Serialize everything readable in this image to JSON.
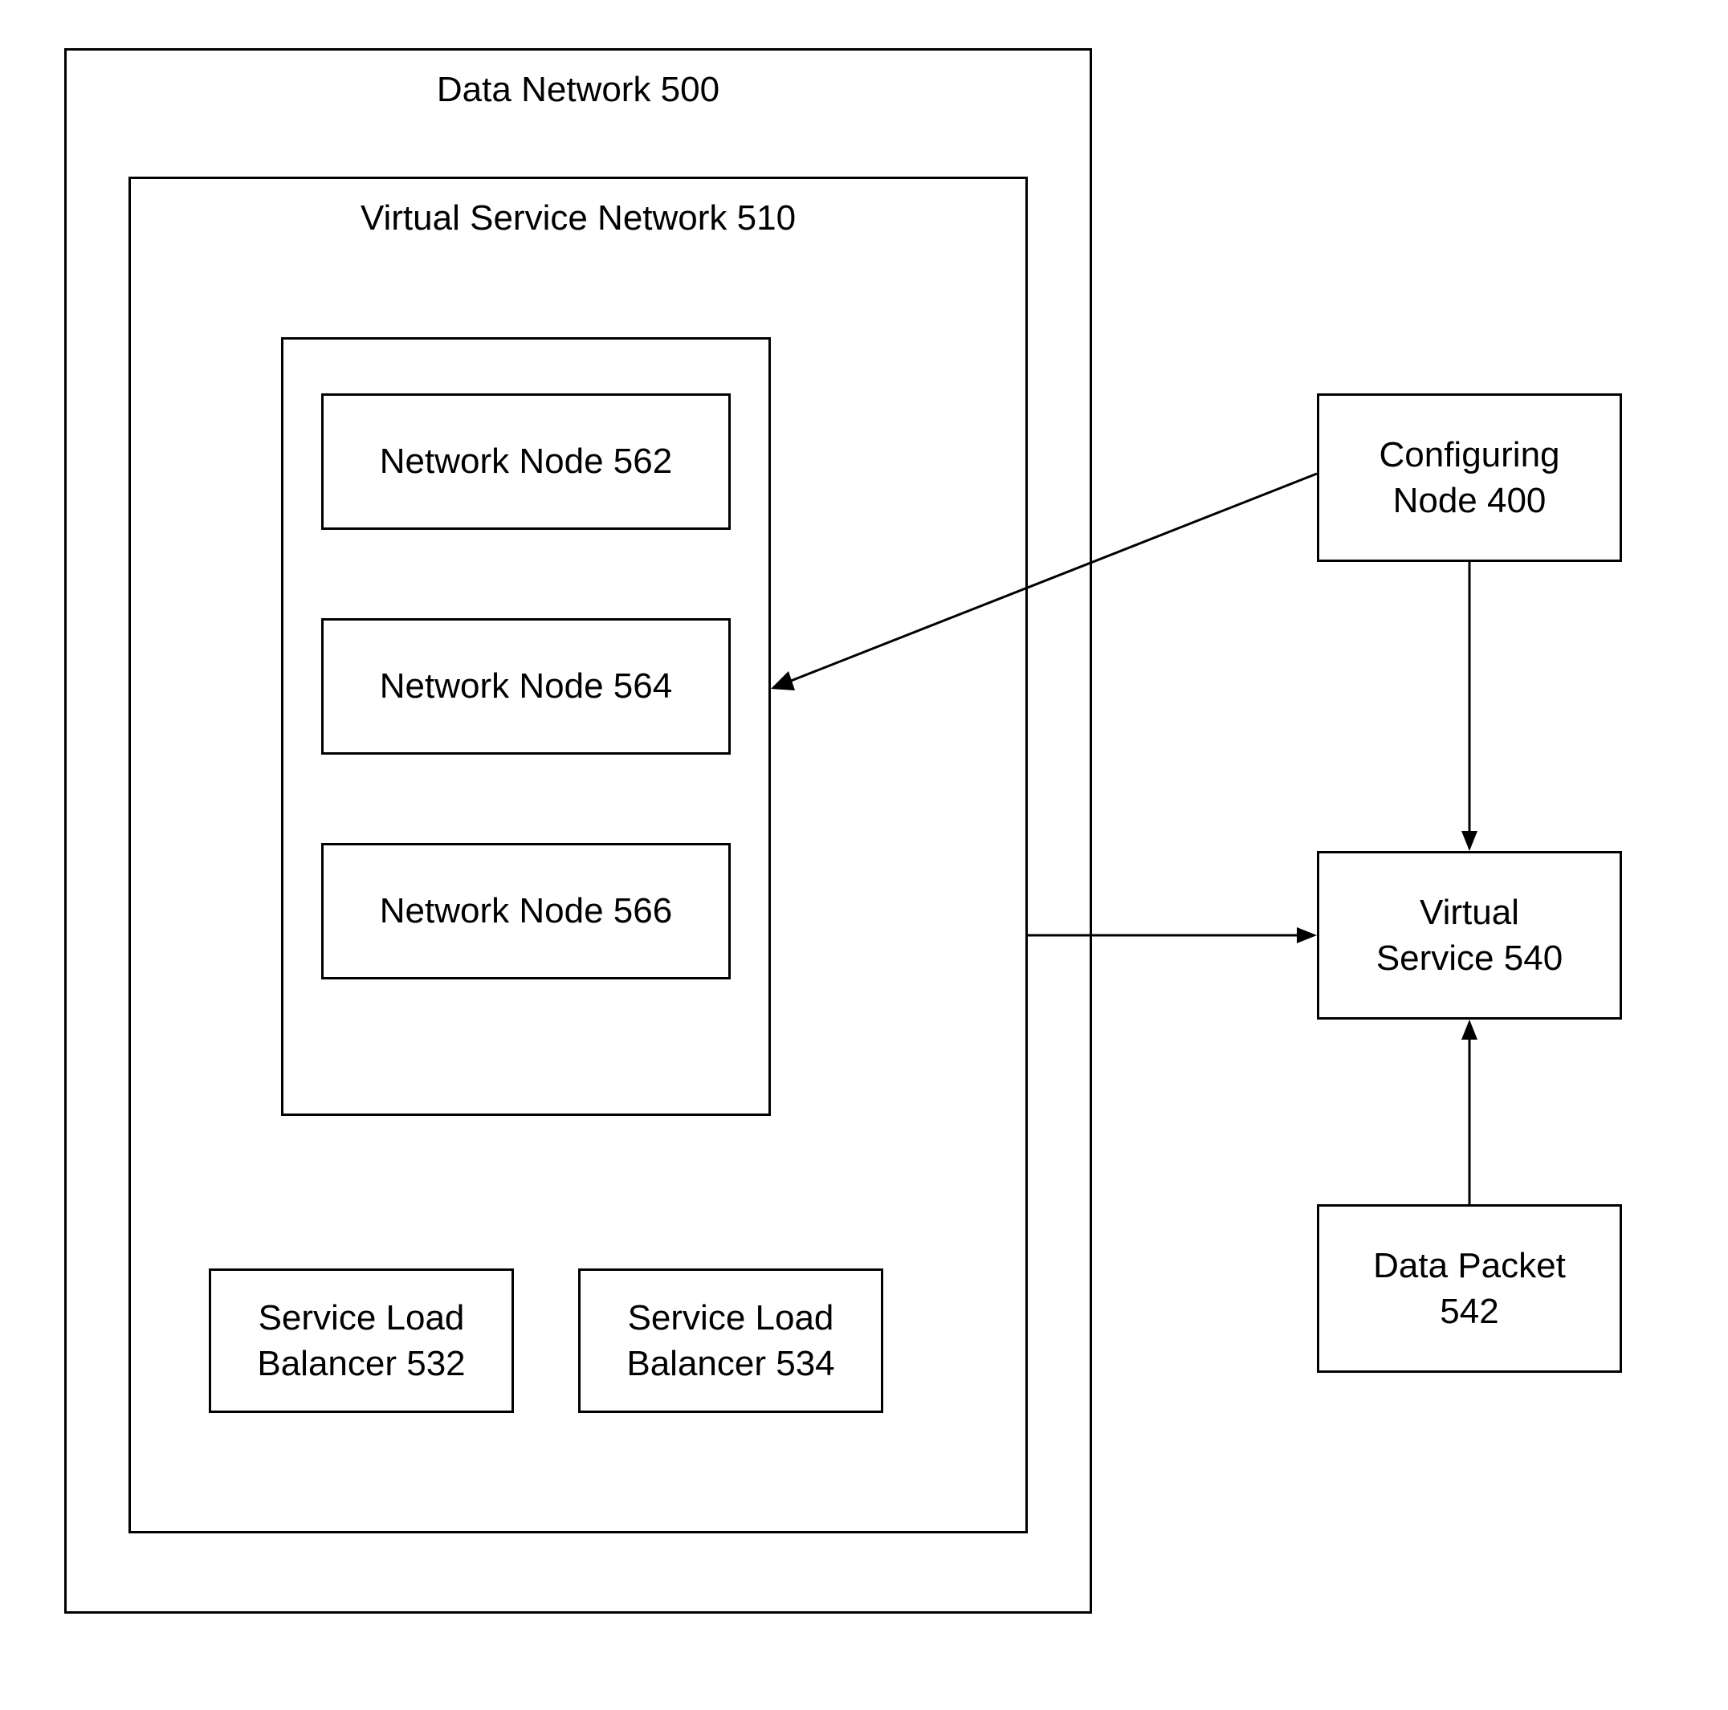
{
  "dataNetwork": {
    "title": "Data Network 500"
  },
  "virtualServiceNetwork": {
    "title": "Virtual Service Network 510"
  },
  "nodes": {
    "node562": "Network Node 562",
    "node564": "Network Node 564",
    "node566": "Network Node 566"
  },
  "balancers": {
    "balancer532_line1": "Service Load",
    "balancer532_line2": "Balancer 532",
    "balancer534_line1": "Service Load",
    "balancer534_line2": "Balancer 534"
  },
  "configuringNode": {
    "line1": "Configuring",
    "line2": "Node 400"
  },
  "virtualService": {
    "line1": "Virtual",
    "line2": "Service 540"
  },
  "dataPacket": {
    "line1": "Data Packet",
    "line2": "542"
  }
}
